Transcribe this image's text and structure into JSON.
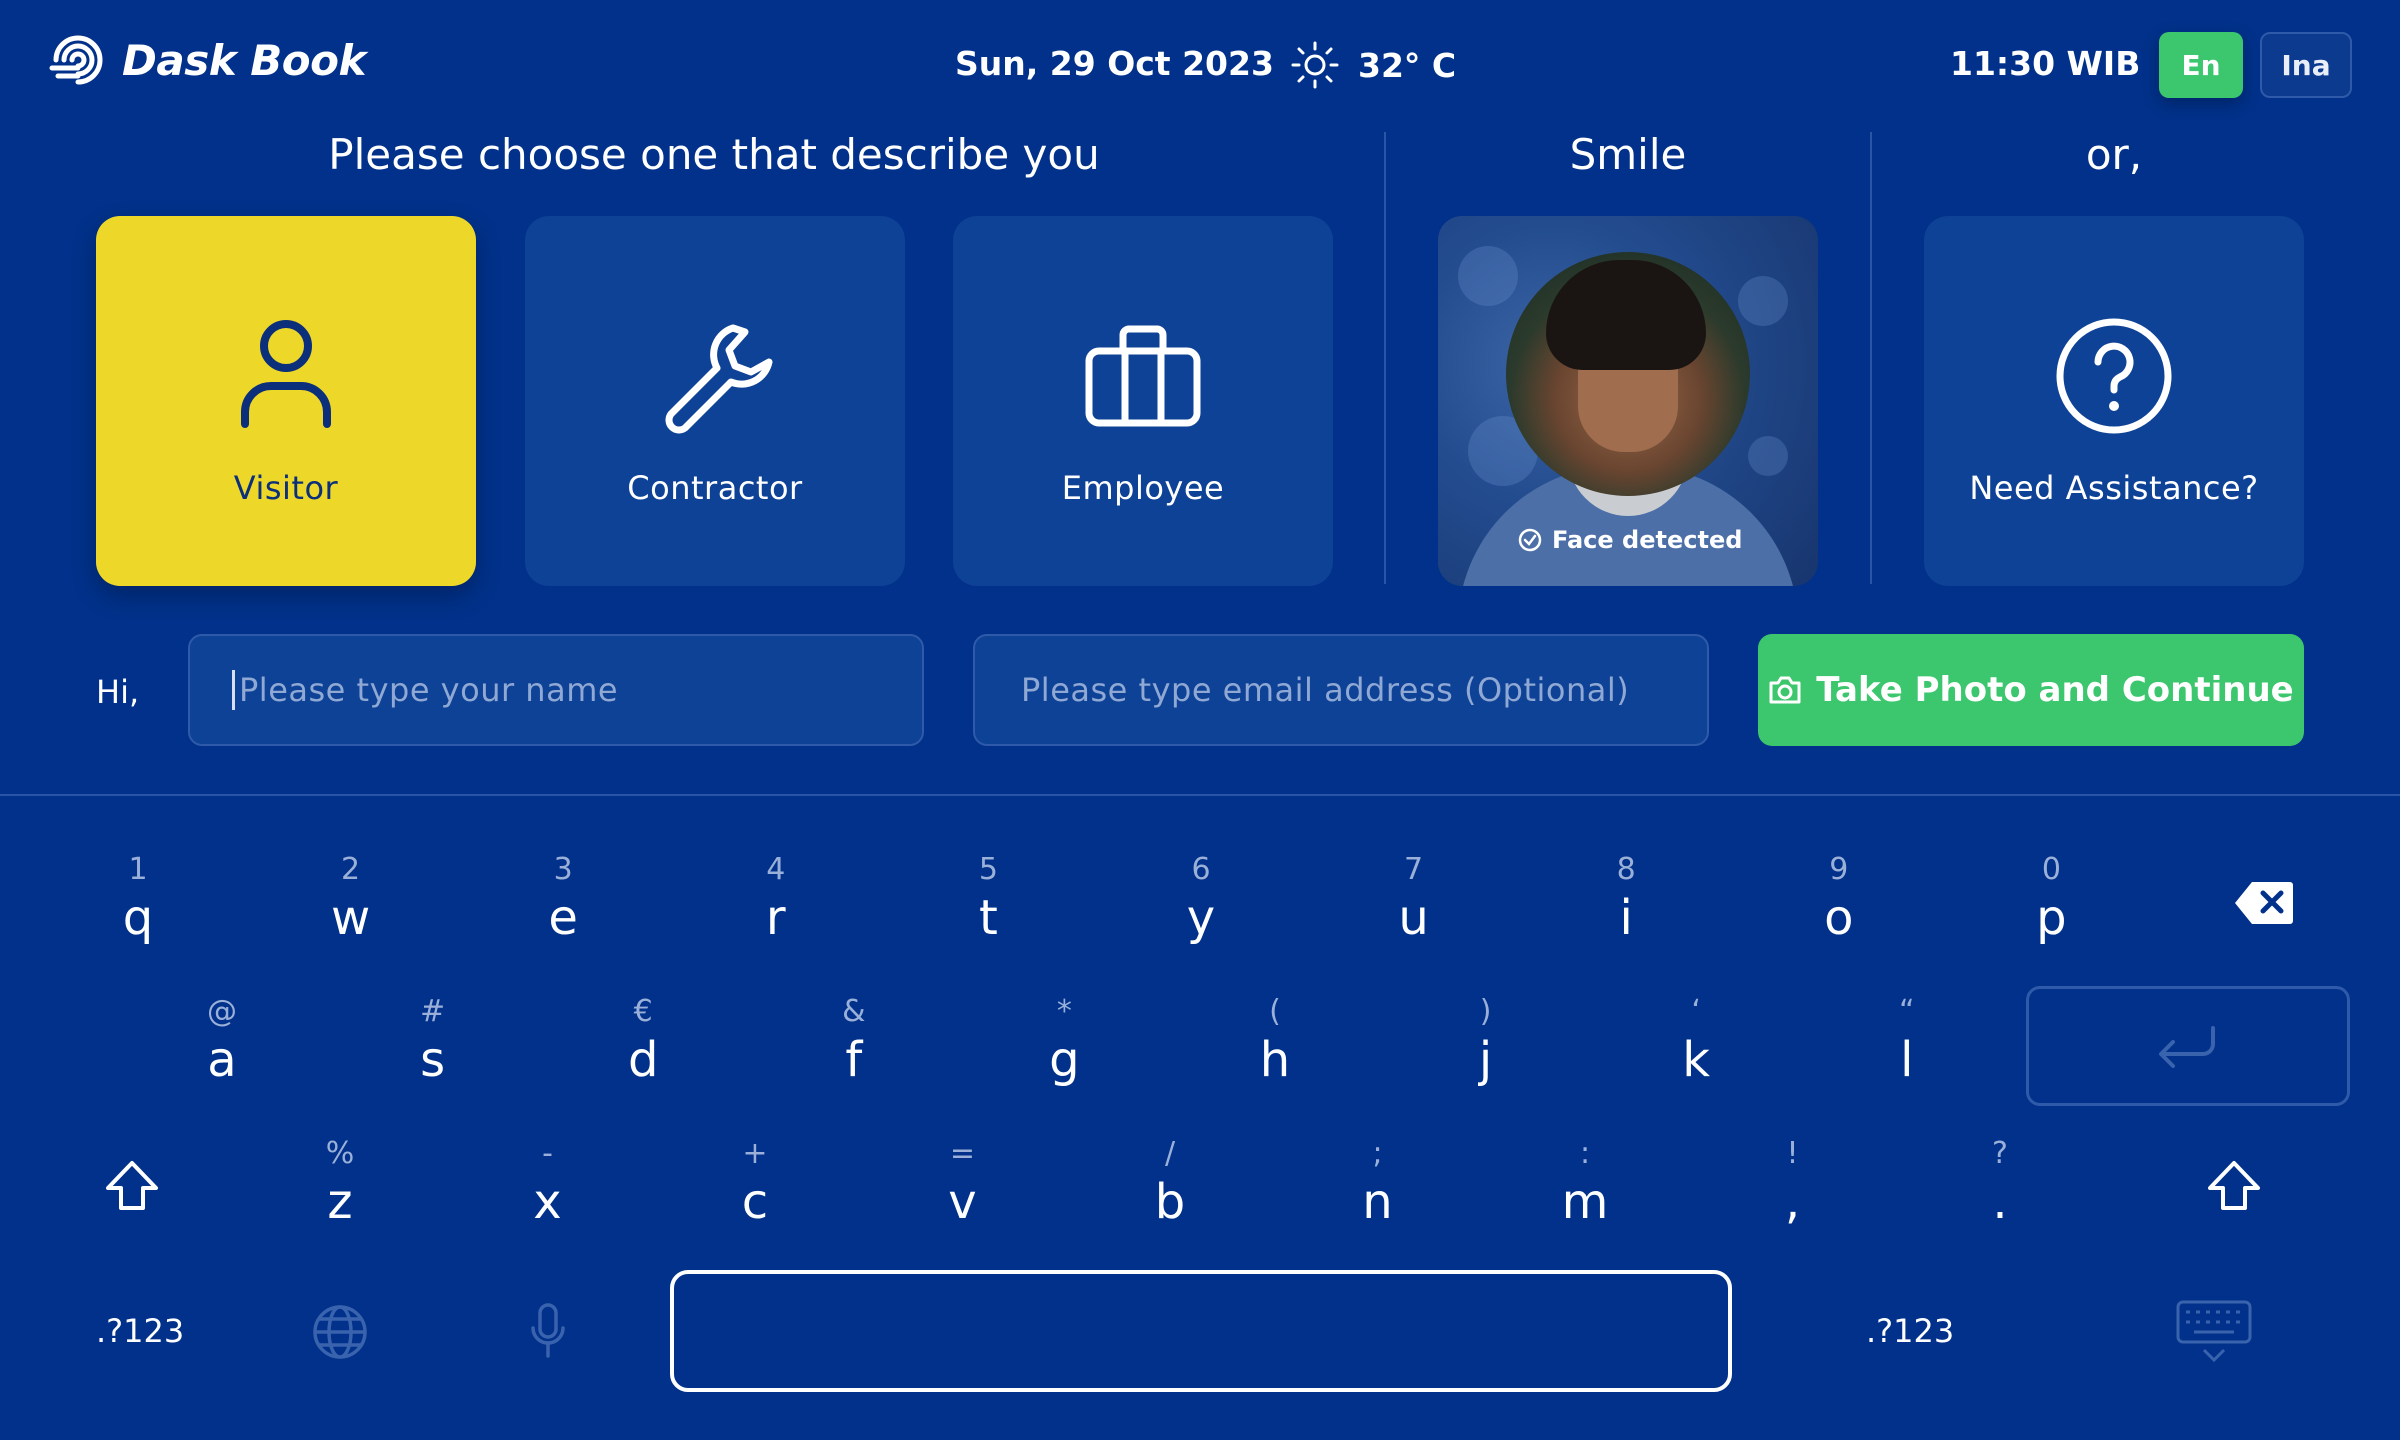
{
  "header": {
    "app_name": "Dask Book",
    "date": "Sun, 29 Oct 2023",
    "weather_icon": "sun-icon",
    "temperature": "32° C",
    "time": "11:30 WIB",
    "languages": [
      "En",
      "Ina"
    ],
    "active_language": "En"
  },
  "main": {
    "choose_title": "Please choose one that describe you",
    "smile_title": "Smile",
    "or_title": "or,",
    "roles": [
      {
        "label": "Visitor",
        "icon": "user-icon",
        "selected": true
      },
      {
        "label": "Contractor",
        "icon": "wrench-icon",
        "selected": false
      },
      {
        "label": "Employee",
        "icon": "briefcase-icon",
        "selected": false
      }
    ],
    "face_status": "Face detected",
    "assistance_label": "Need Assistance?"
  },
  "form": {
    "greeting": "Hi,",
    "name_placeholder": "Please type your name",
    "email_placeholder": "Please type email address (Optional)",
    "continue_label": "Take Photo and Continue"
  },
  "keyboard": {
    "row1": [
      {
        "main": "q",
        "sub": "1"
      },
      {
        "main": "w",
        "sub": "2"
      },
      {
        "main": "e",
        "sub": "3"
      },
      {
        "main": "r",
        "sub": "4"
      },
      {
        "main": "t",
        "sub": "5"
      },
      {
        "main": "y",
        "sub": "6"
      },
      {
        "main": "u",
        "sub": "7"
      },
      {
        "main": "i",
        "sub": "8"
      },
      {
        "main": "o",
        "sub": "9"
      },
      {
        "main": "p",
        "sub": "0"
      }
    ],
    "row2": [
      {
        "main": "a",
        "sub": "@"
      },
      {
        "main": "s",
        "sub": "#"
      },
      {
        "main": "d",
        "sub": "€"
      },
      {
        "main": "f",
        "sub": "&"
      },
      {
        "main": "g",
        "sub": "*"
      },
      {
        "main": "h",
        "sub": "("
      },
      {
        "main": "j",
        "sub": ")"
      },
      {
        "main": "k",
        "sub": "‘"
      },
      {
        "main": "l",
        "sub": "“"
      }
    ],
    "row3": [
      {
        "main": "z",
        "sub": "%"
      },
      {
        "main": "x",
        "sub": "-"
      },
      {
        "main": "c",
        "sub": "+"
      },
      {
        "main": "v",
        "sub": "="
      },
      {
        "main": "b",
        "sub": "/"
      },
      {
        "main": "n",
        "sub": ";"
      },
      {
        "main": "m",
        "sub": ":"
      },
      {
        "main": ",",
        "sub": "!"
      },
      {
        "main": ".",
        "sub": "?"
      }
    ],
    "symbols_left": ".?123",
    "symbols_right": ".?123"
  }
}
